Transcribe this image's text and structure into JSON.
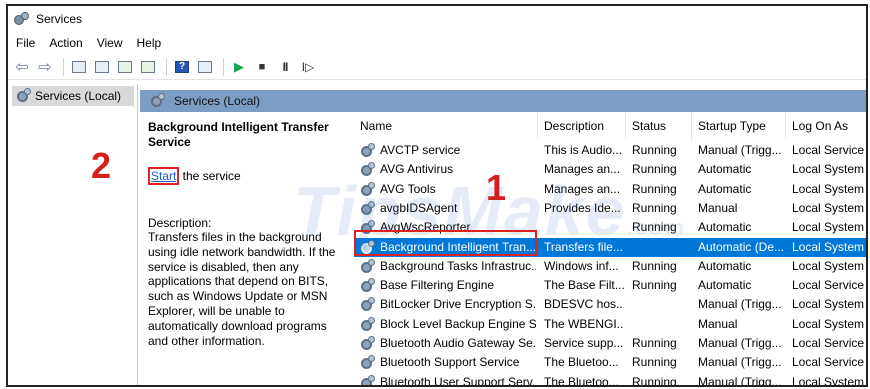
{
  "window": {
    "title": "Services"
  },
  "menu": [
    "File",
    "Action",
    "View",
    "Help"
  ],
  "left_pane": {
    "item": "Services (Local)"
  },
  "right_header": {
    "title": "Services (Local)"
  },
  "extended": {
    "service_name": "Background Intelligent Transfer Service",
    "start_link": "Start",
    "start_suffix": " the service",
    "description_label": "Description:",
    "description_lines": [
      "Transfers files in the background",
      "using idle network bandwidth. If the",
      "service is disabled, then any",
      "applications that depend on BITS,",
      "such as Windows Update or MSN",
      "Explorer, will be unable to",
      "automatically download programs",
      "and other information."
    ]
  },
  "columns": [
    "Name",
    "Description",
    "Status",
    "Startup Type",
    "Log On As"
  ],
  "rows": [
    {
      "name": "AVCTP service",
      "description": "This is Audio...",
      "status": "Running",
      "startup": "Manual (Trigg...",
      "logon": "Local Service"
    },
    {
      "name": "AVG Antivirus",
      "description": "Manages an...",
      "status": "Running",
      "startup": "Automatic",
      "logon": "Local System"
    },
    {
      "name": "AVG Tools",
      "description": "Manages an...",
      "status": "Running",
      "startup": "Automatic",
      "logon": "Local System"
    },
    {
      "name": "avgbIDSAgent",
      "description": "Provides Ide...",
      "status": "Running",
      "startup": "Manual",
      "logon": "Local System"
    },
    {
      "name": "AvgWscReporter",
      "description": "",
      "status": "Running",
      "startup": "Automatic",
      "logon": "Local System"
    },
    {
      "name": "Background Intelligent Tran...",
      "description": "Transfers file...",
      "status": "",
      "startup": "Automatic (De...",
      "logon": "Local System",
      "selected": true
    },
    {
      "name": "Background Tasks Infrastruc...",
      "description": "Windows inf...",
      "status": "Running",
      "startup": "Automatic",
      "logon": "Local System"
    },
    {
      "name": "Base Filtering Engine",
      "description": "The Base Filt...",
      "status": "Running",
      "startup": "Automatic",
      "logon": "Local Service"
    },
    {
      "name": "BitLocker Drive Encryption S...",
      "description": "BDESVC hos...",
      "status": "",
      "startup": "Manual (Trigg...",
      "logon": "Local System"
    },
    {
      "name": "Block Level Backup Engine S...",
      "description": "The WBENGI...",
      "status": "",
      "startup": "Manual",
      "logon": "Local System"
    },
    {
      "name": "Bluetooth Audio Gateway Se...",
      "description": "Service supp...",
      "status": "Running",
      "startup": "Manual (Trigg...",
      "logon": "Local Service"
    },
    {
      "name": "Bluetooth Support Service",
      "description": "The Bluetoo...",
      "status": "Running",
      "startup": "Manual (Trigg...",
      "logon": "Local Service"
    },
    {
      "name": "Bluetooth User Support Serv...",
      "description": "The Bluetoo...",
      "status": "Running",
      "startup": "Manual (Trigg...",
      "logon": "Local System"
    }
  ],
  "annotations": {
    "step1": "1",
    "step2": "2"
  },
  "watermark": {
    "brand": "TipsMake",
    "suffix": ".com"
  },
  "colors": {
    "selection": "#0078d7",
    "header_bar": "#7b9dc4",
    "annotation": "#d3201f",
    "link": "#1a5bd1"
  }
}
